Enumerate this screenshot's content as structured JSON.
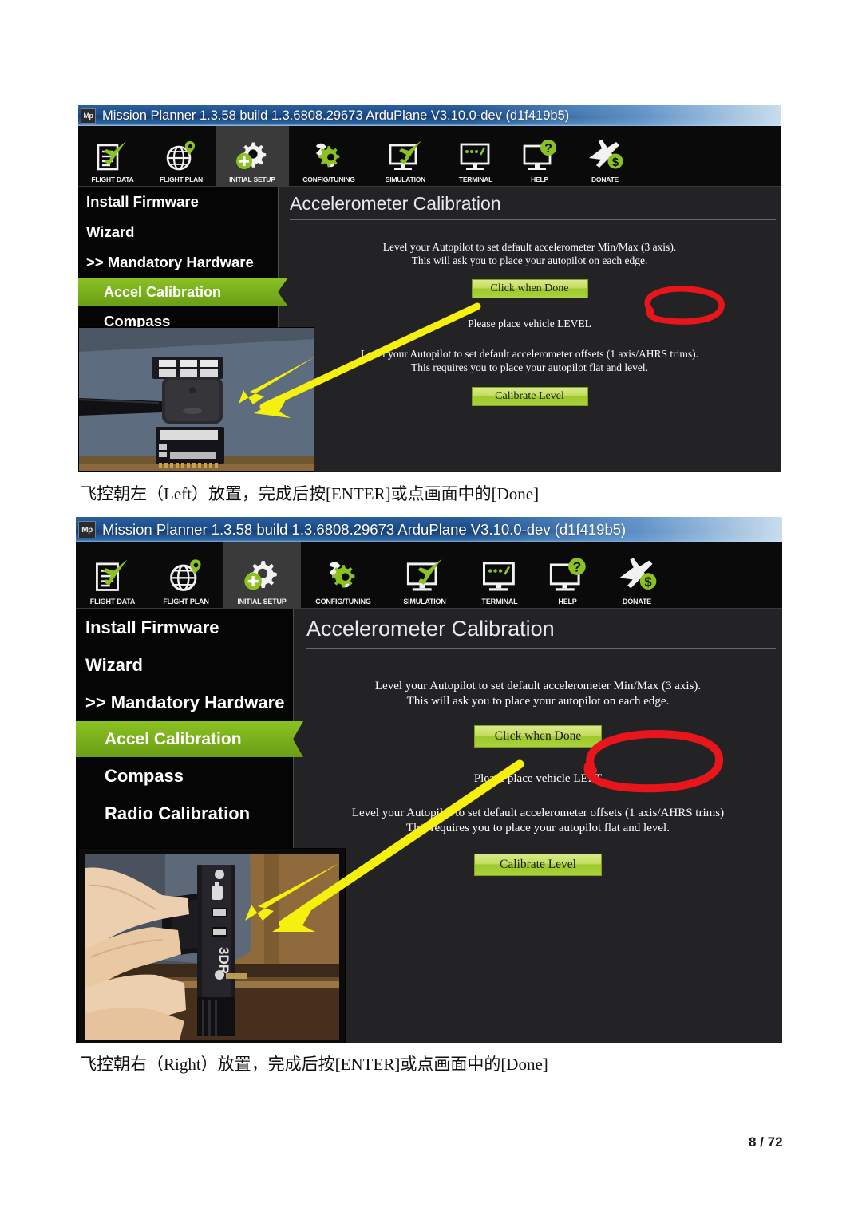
{
  "document": {
    "page_label": "8 / 72"
  },
  "shots": [
    {
      "id": "shot-level",
      "titlebar": {
        "app_icon_text": "Mp",
        "title": "Mission Planner 1.3.58 build 1.3.6808.29673 ArduPlane V3.10.0-dev (d1f419b5)"
      },
      "toolbar": [
        {
          "label": "FLIGHT DATA",
          "icon": "flight-data-icon",
          "active": false
        },
        {
          "label": "FLIGHT PLAN",
          "icon": "flight-plan-icon",
          "active": false
        },
        {
          "label": "INITIAL SETUP",
          "icon": "initial-setup-icon",
          "active": true
        },
        {
          "label": "CONFIG/TUNING",
          "icon": "config-tuning-icon",
          "active": false
        },
        {
          "label": "SIMULATION",
          "icon": "simulation-icon",
          "active": false
        },
        {
          "label": "TERMINAL",
          "icon": "terminal-icon",
          "active": false
        },
        {
          "label": "HELP",
          "icon": "help-icon",
          "active": false
        },
        {
          "label": "DONATE",
          "icon": "donate-icon",
          "active": false
        }
      ],
      "sidebar": [
        {
          "label": "Install Firmware",
          "active": false
        },
        {
          "label": "Wizard",
          "active": false
        },
        {
          "label": ">> Mandatory Hardware",
          "active": false
        },
        {
          "label": "Accel Calibration",
          "active": true
        },
        {
          "label": "Compass",
          "active": false
        }
      ],
      "panel": {
        "title": "Accelerometer Calibration",
        "minmax_line1": "Level your Autopilot to set default accelerometer Min/Max (3 axis).",
        "minmax_line2": "This will ask you to place your autopilot on each edge.",
        "done_button": "Click when Done",
        "status": "Please place vehicle LEVEL",
        "status_prefix": "Please place vehicl",
        "status_highlight": "LEVEL",
        "offsets_line1": "Level your Autopilot to set default accelerometer offsets (1 axis/AHRS trims).",
        "offsets_line2": "This requires you to place your autopilot flat and level.",
        "calibrate_button": "Calibrate Level"
      },
      "annotations": {
        "circle_color": "#e8161b",
        "arrow_color": "#f5f00d"
      },
      "photo": {
        "description": "flight controller lying flat on a blue-grey mat",
        "surface_color": "#5c6b7d"
      }
    },
    {
      "id": "shot-left",
      "titlebar": {
        "app_icon_text": "Mp",
        "title": "Mission Planner 1.3.58 build 1.3.6808.29673 ArduPlane V3.10.0-dev (d1f419b5)"
      },
      "toolbar": [
        {
          "label": "FLIGHT DATA",
          "icon": "flight-data-icon",
          "active": false
        },
        {
          "label": "FLIGHT PLAN",
          "icon": "flight-plan-icon",
          "active": false
        },
        {
          "label": "INITIAL SETUP",
          "icon": "initial-setup-icon",
          "active": true
        },
        {
          "label": "CONFIG/TUNING",
          "icon": "config-tuning-icon",
          "active": false
        },
        {
          "label": "SIMULATION",
          "icon": "simulation-icon",
          "active": false
        },
        {
          "label": "TERMINAL",
          "icon": "terminal-icon",
          "active": false
        },
        {
          "label": "HELP",
          "icon": "help-icon",
          "active": false
        },
        {
          "label": "DONATE",
          "icon": "donate-icon",
          "active": false
        }
      ],
      "sidebar": [
        {
          "label": "Install Firmware",
          "active": false
        },
        {
          "label": "Wizard",
          "active": false
        },
        {
          "label": ">> Mandatory Hardware",
          "active": false
        },
        {
          "label": "Accel Calibration",
          "active": true
        },
        {
          "label": "Compass",
          "active": false
        },
        {
          "label": "Radio Calibration",
          "active": false
        }
      ],
      "panel": {
        "title": "Accelerometer Calibration",
        "minmax_line1": "Level your Autopilot to set default accelerometer Min/Max (3 axis).",
        "minmax_line2": "This will ask you to place your autopilot on each edge.",
        "done_button": "Click when Done",
        "status": "Please place vehicle LEFT",
        "status_prefix": "Please place",
        "status_highlight": "vehicle LEFT",
        "offsets_line1": "Level your Autopilot to set default accelerometer offsets (1 axis/AHRS trims)",
        "offsets_line2": "This requires you to place your autopilot flat and level.",
        "calibrate_button": "Calibrate Level"
      },
      "annotations": {
        "circle_color": "#e8161b",
        "arrow_color": "#f5f00d"
      },
      "photo": {
        "description": "hand holding flight controller upright on its edge beside a wooden desk",
        "surface_color": "#6d7b8c"
      }
    }
  ],
  "captions": [
    "飞控朝左（Left）放置，完成后按[ENTER]或点画面中的[Done]",
    "飞控朝右（Right）放置，完成后按[ENTER]或点画面中的[Done]"
  ]
}
